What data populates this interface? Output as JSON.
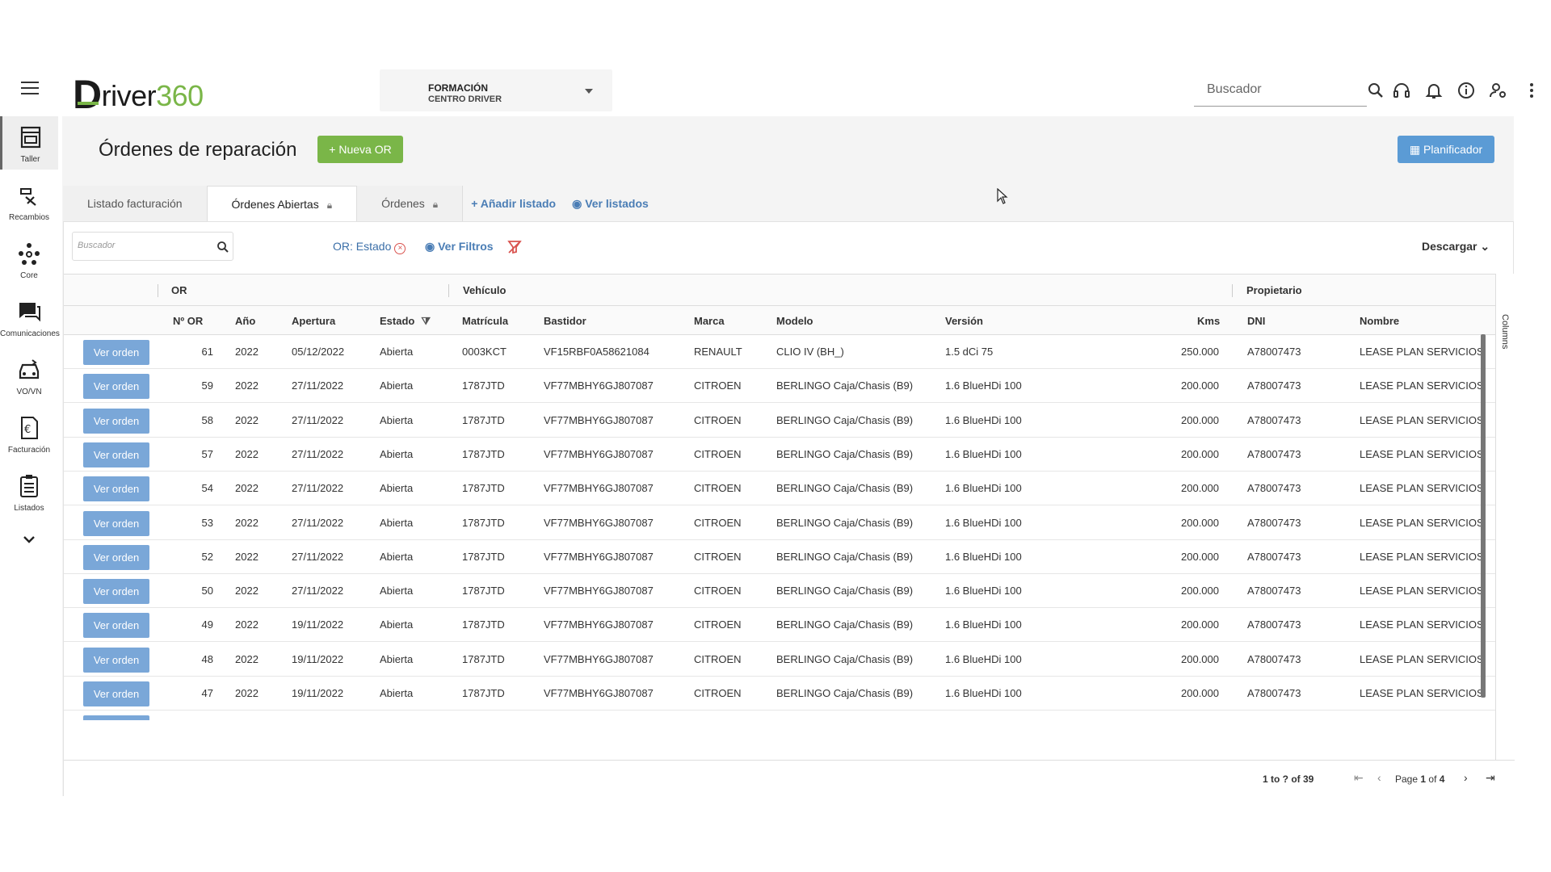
{
  "header": {
    "logo": {
      "prefix": "D",
      "word": "river",
      "number": "360"
    },
    "company": {
      "line1": "FORMACIÓN",
      "line2": "CENTRO DRIVER"
    },
    "search": {
      "placeholder": "Buscador"
    },
    "icons": [
      "search-icon",
      "headset-icon",
      "bell-icon",
      "info-icon",
      "user-settings-icon",
      "more-vert-icon"
    ]
  },
  "sidebar": {
    "items": [
      {
        "label": "Taller",
        "icon": "workshop-icon"
      },
      {
        "label": "Recambios",
        "icon": "tools-icon"
      },
      {
        "label": "Core",
        "icon": "network-icon"
      },
      {
        "label": "Comunicaciones",
        "icon": "chat-icon"
      },
      {
        "label": "VO/VN",
        "icon": "car-icon"
      },
      {
        "label": "Facturación",
        "icon": "invoice-euro-icon"
      },
      {
        "label": "Listados",
        "icon": "clipboard-list-icon"
      }
    ]
  },
  "page": {
    "title": "Órdenes de reparación",
    "new_button": "+ Nueva OR",
    "planner_button": "Planificador"
  },
  "tabs": [
    {
      "label": "Listado facturación",
      "locked": false
    },
    {
      "label": "Órdenes Abiertas",
      "locked": true
    },
    {
      "label": "Órdenes",
      "locked": true
    }
  ],
  "tab_actions": {
    "add": "Añadir listado",
    "view": "Ver listados"
  },
  "toolbar": {
    "search_placeholder": "Buscador",
    "filter_chip": "OR: Estado",
    "view_filters": "Ver Filtros",
    "download": "Descargar"
  },
  "grid": {
    "groups": {
      "or": "OR",
      "vehicle": "Vehículo",
      "owner": "Propietario"
    },
    "columns": {
      "n_or": "Nº OR",
      "anio": "Año",
      "apertura": "Apertura",
      "estado": "Estado",
      "matricula": "Matrícula",
      "bastidor": "Bastidor",
      "marca": "Marca",
      "modelo": "Modelo",
      "version": "Versión",
      "kms": "Kms",
      "dni": "DNI",
      "nombre": "Nombre"
    },
    "row_button": "Ver orden",
    "rows": [
      {
        "n_or": "61",
        "anio": "2022",
        "apertura": "05/12/2022",
        "estado": "Abierta",
        "matricula": "0003KCT",
        "bastidor": "VF15RBF0A58621084",
        "marca": "RENAULT",
        "modelo": "CLIO IV (BH_)",
        "version": "1.5 dCi 75",
        "kms": "250.000",
        "dni": "A78007473",
        "nombre": "LEASE PLAN SERVICIOS"
      },
      {
        "n_or": "59",
        "anio": "2022",
        "apertura": "27/11/2022",
        "estado": "Abierta",
        "matricula": "1787JTD",
        "bastidor": "VF77MBHY6GJ807087",
        "marca": "CITROEN",
        "modelo": "BERLINGO Caja/Chasis (B9)",
        "version": "1.6 BlueHDi 100",
        "kms": "200.000",
        "dni": "A78007473",
        "nombre": "LEASE PLAN SERVICIOS"
      },
      {
        "n_or": "58",
        "anio": "2022",
        "apertura": "27/11/2022",
        "estado": "Abierta",
        "matricula": "1787JTD",
        "bastidor": "VF77MBHY6GJ807087",
        "marca": "CITROEN",
        "modelo": "BERLINGO Caja/Chasis (B9)",
        "version": "1.6 BlueHDi 100",
        "kms": "200.000",
        "dni": "A78007473",
        "nombre": "LEASE PLAN SERVICIOS"
      },
      {
        "n_or": "57",
        "anio": "2022",
        "apertura": "27/11/2022",
        "estado": "Abierta",
        "matricula": "1787JTD",
        "bastidor": "VF77MBHY6GJ807087",
        "marca": "CITROEN",
        "modelo": "BERLINGO Caja/Chasis (B9)",
        "version": "1.6 BlueHDi 100",
        "kms": "200.000",
        "dni": "A78007473",
        "nombre": "LEASE PLAN SERVICIOS"
      },
      {
        "n_or": "54",
        "anio": "2022",
        "apertura": "27/11/2022",
        "estado": "Abierta",
        "matricula": "1787JTD",
        "bastidor": "VF77MBHY6GJ807087",
        "marca": "CITROEN",
        "modelo": "BERLINGO Caja/Chasis (B9)",
        "version": "1.6 BlueHDi 100",
        "kms": "200.000",
        "dni": "A78007473",
        "nombre": "LEASE PLAN SERVICIOS"
      },
      {
        "n_or": "53",
        "anio": "2022",
        "apertura": "27/11/2022",
        "estado": "Abierta",
        "matricula": "1787JTD",
        "bastidor": "VF77MBHY6GJ807087",
        "marca": "CITROEN",
        "modelo": "BERLINGO Caja/Chasis (B9)",
        "version": "1.6 BlueHDi 100",
        "kms": "200.000",
        "dni": "A78007473",
        "nombre": "LEASE PLAN SERVICIOS"
      },
      {
        "n_or": "52",
        "anio": "2022",
        "apertura": "27/11/2022",
        "estado": "Abierta",
        "matricula": "1787JTD",
        "bastidor": "VF77MBHY6GJ807087",
        "marca": "CITROEN",
        "modelo": "BERLINGO Caja/Chasis (B9)",
        "version": "1.6 BlueHDi 100",
        "kms": "200.000",
        "dni": "A78007473",
        "nombre": "LEASE PLAN SERVICIOS"
      },
      {
        "n_or": "50",
        "anio": "2022",
        "apertura": "27/11/2022",
        "estado": "Abierta",
        "matricula": "1787JTD",
        "bastidor": "VF77MBHY6GJ807087",
        "marca": "CITROEN",
        "modelo": "BERLINGO Caja/Chasis (B9)",
        "version": "1.6 BlueHDi 100",
        "kms": "200.000",
        "dni": "A78007473",
        "nombre": "LEASE PLAN SERVICIOS"
      },
      {
        "n_or": "49",
        "anio": "2022",
        "apertura": "19/11/2022",
        "estado": "Abierta",
        "matricula": "1787JTD",
        "bastidor": "VF77MBHY6GJ807087",
        "marca": "CITROEN",
        "modelo": "BERLINGO Caja/Chasis (B9)",
        "version": "1.6 BlueHDi 100",
        "kms": "200.000",
        "dni": "A78007473",
        "nombre": "LEASE PLAN SERVICIOS"
      },
      {
        "n_or": "48",
        "anio": "2022",
        "apertura": "19/11/2022",
        "estado": "Abierta",
        "matricula": "1787JTD",
        "bastidor": "VF77MBHY6GJ807087",
        "marca": "CITROEN",
        "modelo": "BERLINGO Caja/Chasis (B9)",
        "version": "1.6 BlueHDi 100",
        "kms": "200.000",
        "dni": "A78007473",
        "nombre": "LEASE PLAN SERVICIOS"
      },
      {
        "n_or": "47",
        "anio": "2022",
        "apertura": "19/11/2022",
        "estado": "Abierta",
        "matricula": "1787JTD",
        "bastidor": "VF77MBHY6GJ807087",
        "marca": "CITROEN",
        "modelo": "BERLINGO Caja/Chasis (B9)",
        "version": "1.6 BlueHDi 100",
        "kms": "200.000",
        "dni": "A78007473",
        "nombre": "LEASE PLAN SERVICIOS"
      }
    ],
    "columns_label": "Columns"
  },
  "pagination": {
    "range": "1 to ? of 39",
    "page_label": "Page",
    "page": "1",
    "of_label": "of",
    "total_pages": "4"
  },
  "colors": {
    "green": "#7ab648",
    "blue_button": "#7aa7d8",
    "planner": "#5b9bd5",
    "link": "#4a7db5"
  }
}
